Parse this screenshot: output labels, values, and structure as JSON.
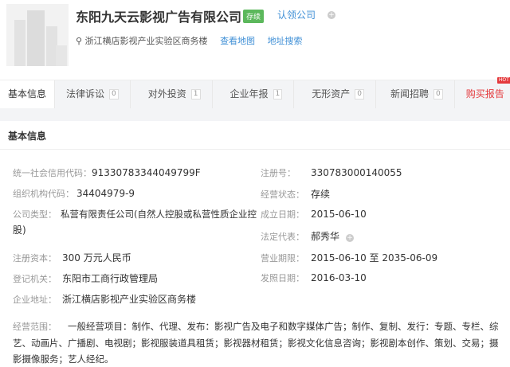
{
  "company": {
    "name": "东阳九天云影视广告有限公司",
    "status_badge": "存续",
    "claim": "认领公司",
    "address": "浙江横店影视产业实验区商务楼",
    "view_map": "查看地图",
    "address_search": "地址搜索"
  },
  "tabs": [
    {
      "label": "基本信息"
    },
    {
      "label": "法律诉讼",
      "count": "0"
    },
    {
      "label": "对外投资",
      "count": "1"
    },
    {
      "label": "企业年报",
      "count": "1"
    },
    {
      "label": "无形资产",
      "count": "0"
    },
    {
      "label": "新闻招聘",
      "count": "0"
    },
    {
      "label": "购买报告",
      "hot": "HOT"
    }
  ],
  "section_title": "基本信息",
  "fields": {
    "credit_code": {
      "label": "统一社会信用代码：",
      "value": "91330783344049799F"
    },
    "org_code": {
      "label": "组织机构代码：",
      "value": "34404979-9"
    },
    "company_type": {
      "label": "公司类型：",
      "value1": "私营有限责任公司(自然人控股或私营性质企业控",
      "value2": "股)"
    },
    "reg_capital": {
      "label": "注册资本：",
      "value": "300 万元人民币"
    },
    "authority": {
      "label": "登记机关：",
      "value": "东阳市工商行政管理局"
    },
    "address": {
      "label": "企业地址：",
      "value": "浙江横店影视产业实验区商务楼"
    },
    "reg_no": {
      "label": "注册号：",
      "value": "330783000140055"
    },
    "op_status": {
      "label": "经营状态：",
      "value": "存续"
    },
    "founded": {
      "label": "成立日期：",
      "value": "2015-06-10"
    },
    "legal_rep": {
      "label": "法定代表：",
      "value": "郝秀华"
    },
    "term": {
      "label": "营业期限：",
      "value": "2015-06-10 至 2035-06-09"
    },
    "issue_date": {
      "label": "发照日期：",
      "value": "2016-03-10"
    },
    "scope": {
      "label": "经营范围：",
      "value": "一般经营项目：制作、代理、发布：影视广告及电子和数字媒体广告；制作、复制、发行：专题、专栏、综艺、动画片、广播剧、电视剧；影视服装道具租赁；影视器材租赁；影视文化信息咨询；影视剧本创作、策划、交易；摄影摄像服务；艺人经纪。"
    }
  },
  "colors": {
    "link": "#3f8fd6",
    "badge": "#5cb85c",
    "hot": "#e4393c"
  }
}
